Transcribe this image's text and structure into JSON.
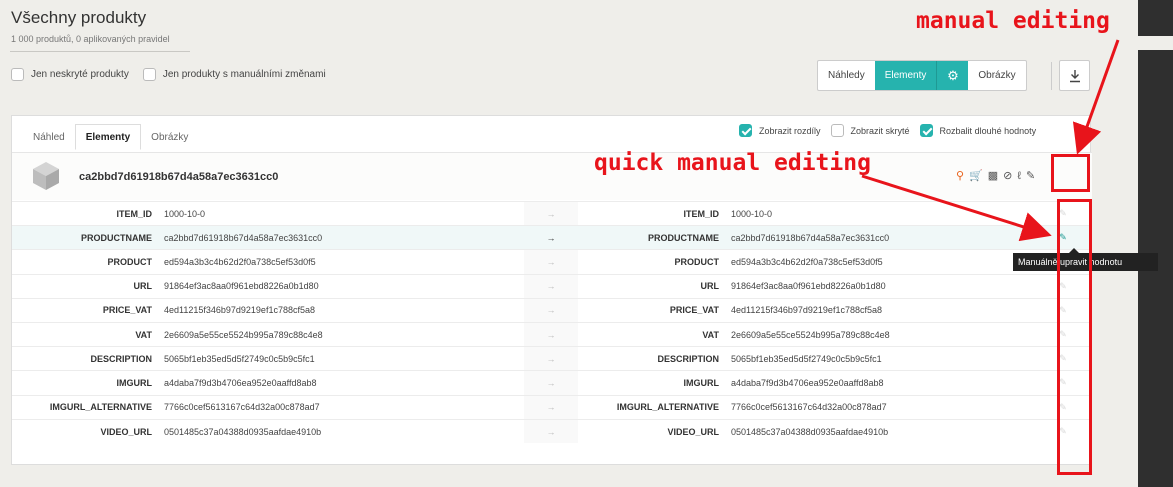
{
  "header": {
    "title": "Všechny produkty",
    "subtitle": "1 000 produktů, 0 aplikovaných pravidel"
  },
  "filters": [
    {
      "label": "Jen neskryté produkty",
      "checked": false
    },
    {
      "label": "Jen produkty s manuálními změnami",
      "checked": false
    }
  ],
  "view_switch": {
    "items": [
      "Náhledy",
      "Elementy",
      "Obrázky"
    ],
    "active": "Elementy",
    "settings_icon": "gear-icon",
    "download_icon": "download-icon"
  },
  "panel": {
    "tabs": [
      "Náhled",
      "Elementy",
      "Obrázky"
    ],
    "active_tab": "Elementy",
    "options": [
      {
        "label": "Zobrazit rozdíly",
        "checked": true
      },
      {
        "label": "Zobrazit skryté",
        "checked": false
      },
      {
        "label": "Rozbalit dlouhé hodnoty",
        "checked": true
      }
    ],
    "product_id": "ca2bbd7d61918b67d4a58a7ec3631cc0",
    "tool_icons": [
      "search-target-icon",
      "cart-icon",
      "chart-icon",
      "hidden-icon",
      "wand-icon",
      "pencil-icon"
    ]
  },
  "rows": [
    {
      "key": "ITEM_ID",
      "left": "1000-10-0",
      "right": "1000-10-0"
    },
    {
      "key": "PRODUCTNAME",
      "left": "ca2bbd7d61918b67d4a58a7ec3631cc0",
      "right": "ca2bbd7d61918b67d4a58a7ec3631cc0"
    },
    {
      "key": "PRODUCT",
      "left": "ed594a3b3c4b62d2f0a738c5ef53d0f5",
      "right": "ed594a3b3c4b62d2f0a738c5ef53d0f5"
    },
    {
      "key": "URL",
      "left": "91864ef3ac8aa0f961ebd8226a0b1d80",
      "right": "91864ef3ac8aa0f961ebd8226a0b1d80"
    },
    {
      "key": "PRICE_VAT",
      "left": "4ed11215f346b97d9219ef1c788cf5a8",
      "right": "4ed11215f346b97d9219ef1c788cf5a8"
    },
    {
      "key": "VAT",
      "left": "2e6609a5e55ce5524b995a789c88c4e8",
      "right": "2e6609a5e55ce5524b995a789c88c4e8"
    },
    {
      "key": "DESCRIPTION",
      "left": "5065bf1eb35ed5d5f2749c0c5b9c5fc1",
      "right": "5065bf1eb35ed5d5f2749c0c5b9c5fc1"
    },
    {
      "key": "IMGURL",
      "left": "a4daba7f9d3b4706ea952e0aaffd8ab8",
      "right": "a4daba7f9d3b4706ea952e0aaffd8ab8"
    },
    {
      "key": "IMGURL_ALTERNATIVE",
      "left": "7766c0cef5613167c64d32a00c878ad7",
      "right": "7766c0cef5613167c64d32a00c878ad7"
    },
    {
      "key": "VIDEO_URL",
      "left": "0501485c37a04388d0935aafdae4910b",
      "right": "0501485c37a04388d0935aafdae4910b"
    }
  ],
  "tooltip": "Manuálně upravit hodnotu",
  "annotations": {
    "manual": "manual editing",
    "quick": "quick manual editing"
  },
  "colors": {
    "accent": "#26b3ae",
    "annotation": "#e8141b"
  }
}
